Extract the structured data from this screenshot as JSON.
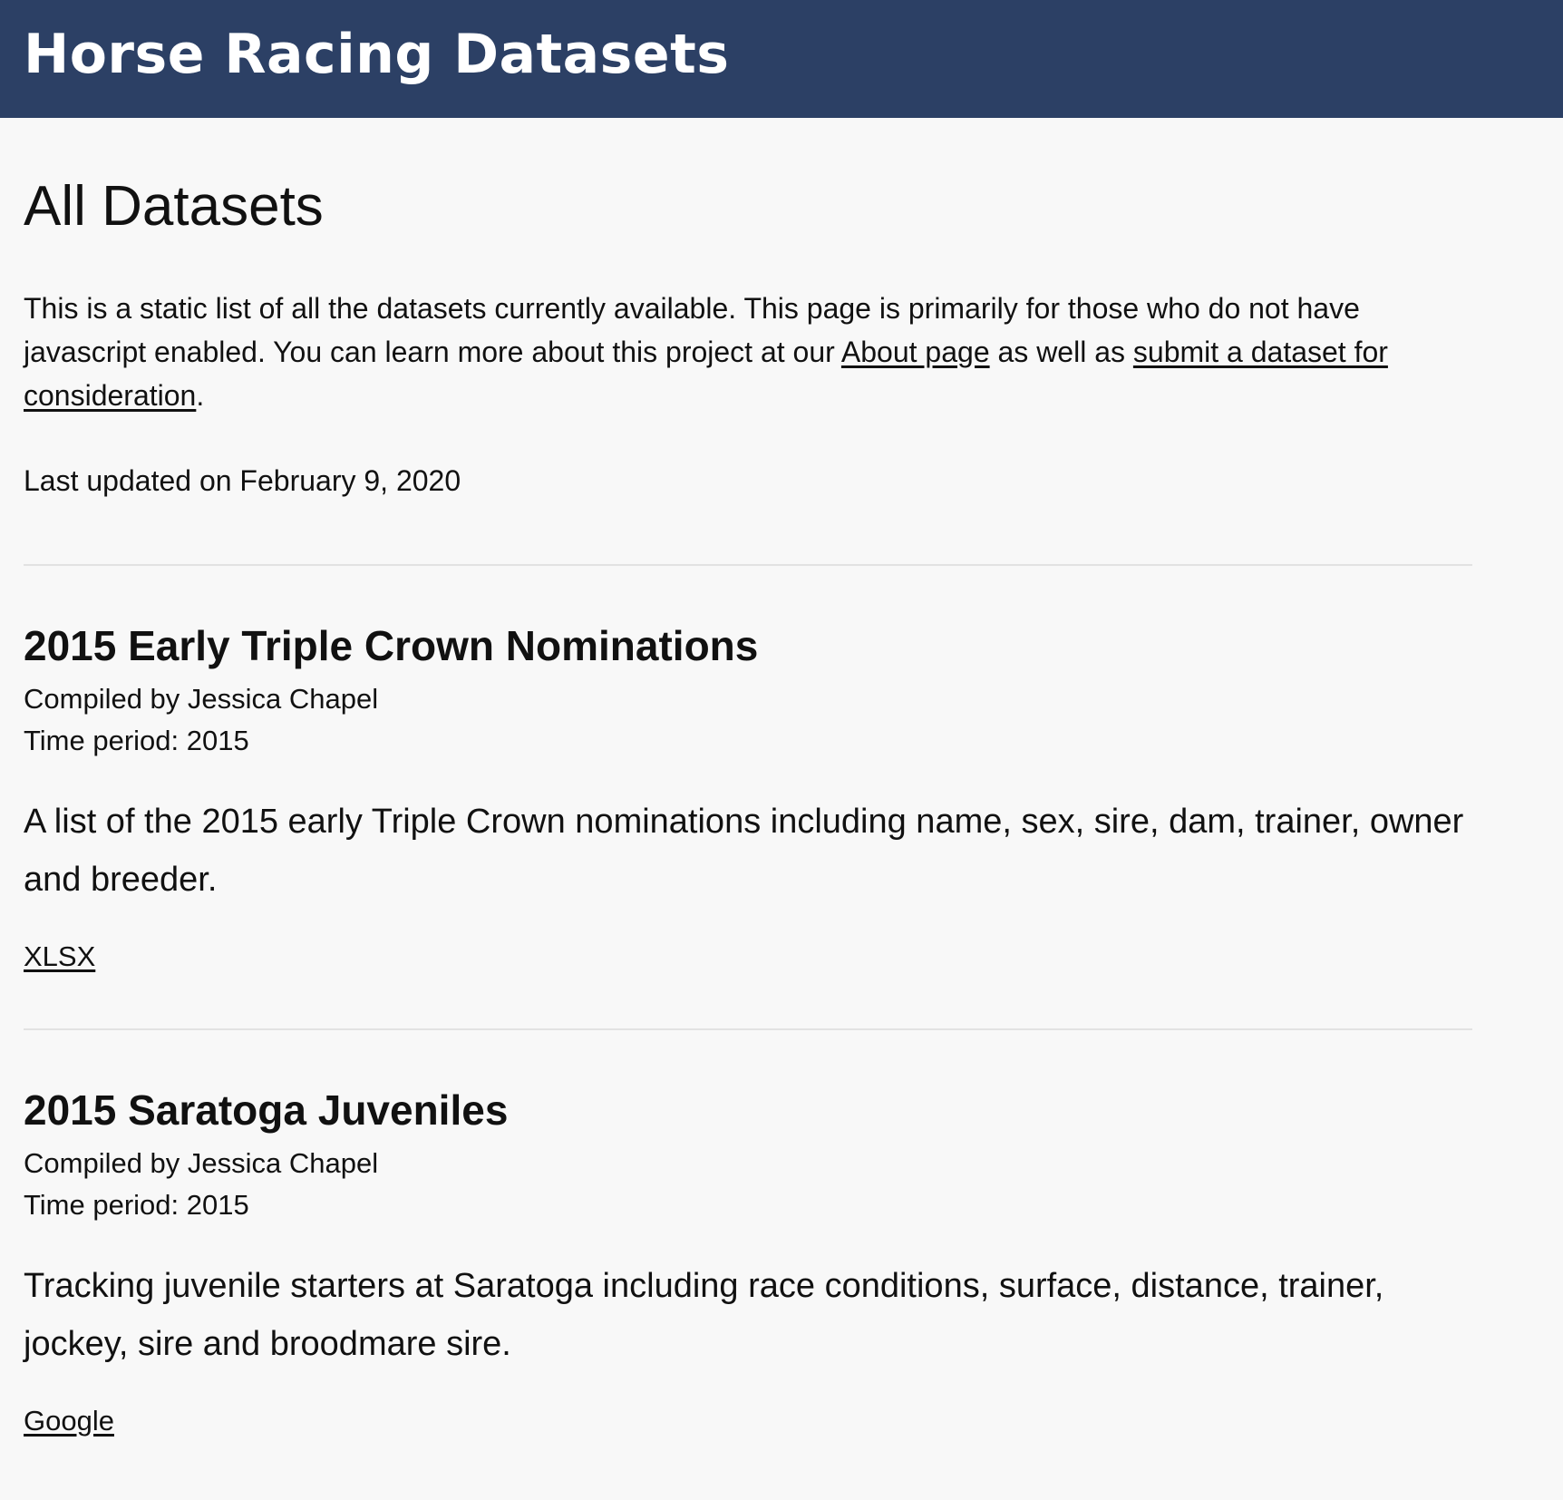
{
  "header": {
    "site_title": "Horse Racing Datasets"
  },
  "page": {
    "title": "All Datasets",
    "intro": {
      "text_1": "This is a static list of all the datasets currently available. This page is primarily for those who do not have javascript enabled. You can learn more about this project at our ",
      "about_link": "About page",
      "text_2": " as well as ",
      "submit_link": "submit a dataset for consideration",
      "text_3": "."
    },
    "last_updated": "Last updated on February 9, 2020"
  },
  "datasets": [
    {
      "title": "2015 Early Triple Crown Nominations",
      "compiled_by": "Compiled by Jessica Chapel",
      "time_period": "Time period: 2015",
      "description": "A list of the 2015 early Triple Crown nominations including name, sex, sire, dam, trainer, owner and breeder.",
      "link": "XLSX"
    },
    {
      "title": "2015 Saratoga Juveniles",
      "compiled_by": "Compiled by Jessica Chapel",
      "time_period": "Time period: 2015",
      "description": "Tracking juvenile starters at Saratoga including race conditions, surface, distance, trainer, jockey, sire and broodmare sire.",
      "link": "Google"
    }
  ],
  "colors": {
    "header_bg": "#2c4065",
    "page_bg": "#f8f8f8",
    "text": "#111111",
    "divider": "#e2e2e2"
  }
}
